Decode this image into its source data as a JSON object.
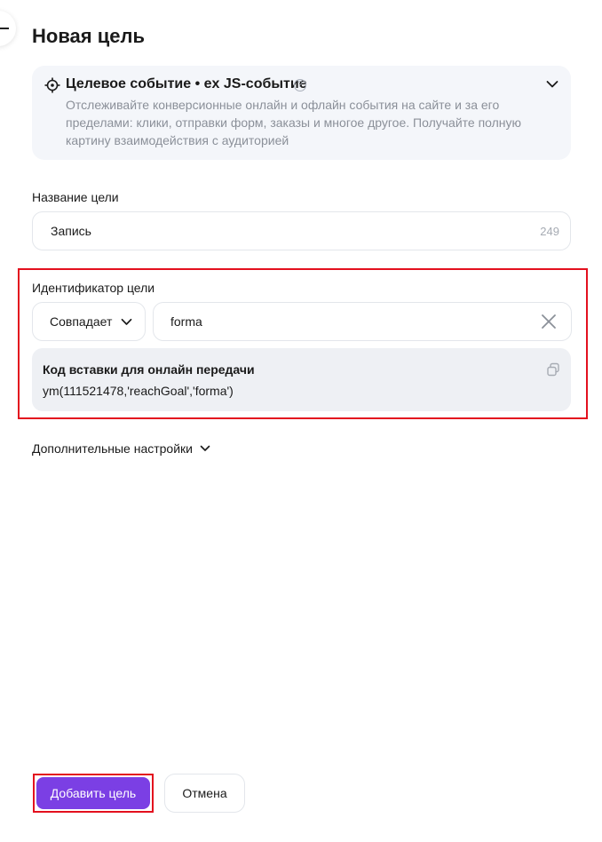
{
  "page": {
    "title": "Новая цель"
  },
  "goal_type": {
    "title": "Целевое событие • ex JS-событие",
    "help_glyph": "?",
    "description": "Отслеживайте конверсионные онлайн и офлайн события на сайте и за его пределами: клики, отправки форм, заказы и многое другое. Получайте полную картину взаимодействия с аудиторией",
    "icon": "target-icon",
    "expand_icon": "chevron-down-icon"
  },
  "goal_name": {
    "label": "Название цели",
    "value": "Запись",
    "counter": "249"
  },
  "goal_identifier": {
    "label": "Идентификатор цели",
    "match_value": "Совпадает",
    "value": "forma",
    "clear_icon": "close-icon"
  },
  "code_snippet": {
    "title": "Код вставки для онлайн передачи",
    "code": "ym(111521478,'reachGoal','forma')",
    "copy_icon": "copy-icon"
  },
  "advanced": {
    "label": "Дополнительные настройки"
  },
  "actions": {
    "add_label": "Добавить цель",
    "cancel_label": "Отмена"
  },
  "colors": {
    "primary": "#7b3fe4",
    "highlight": "#e3101e",
    "panel_bg": "#f4f6fa",
    "code_bg": "#eef0f4",
    "muted_text": "#8b9099"
  }
}
